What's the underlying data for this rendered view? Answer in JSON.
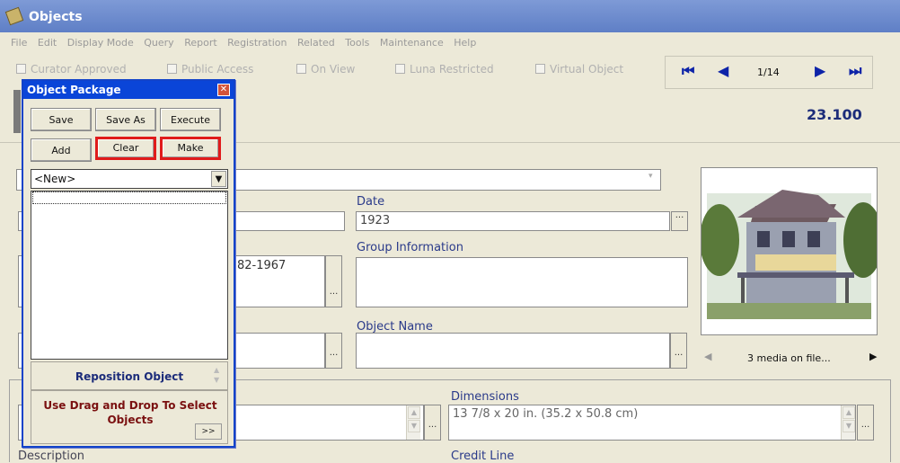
{
  "window": {
    "title": "Objects"
  },
  "menu": [
    "File",
    "Edit",
    "Display Mode",
    "Query",
    "Report",
    "Registration",
    "Related",
    "Tools",
    "Maintenance",
    "Help"
  ],
  "checkboxes": [
    "Curator Approved",
    "Public Access",
    "On View",
    "Luna Restricted",
    "Virtual Object"
  ],
  "nav": {
    "record": "1/14"
  },
  "object_number": "23.100",
  "fields": {
    "date_label": "Date",
    "date_value": "1923",
    "group_label": "Group Information",
    "group_value": "",
    "objname_label": "Object Name",
    "objname_value": "",
    "constituent_value": "82-1967",
    "dimensions_label": "Dimensions",
    "dimensions_value": "13 7/8 x 20 in. (35.2 x 50.8 cm)",
    "credit_label": "Credit Line",
    "description_label": "Description"
  },
  "media": {
    "label": "3 media on file..."
  },
  "package": {
    "title": "Object Package",
    "buttons": {
      "save": "Save",
      "save_as": "Save As",
      "execute": "Execute",
      "add": "Add",
      "clear": "Clear",
      "make": "Make"
    },
    "dropdown_value": "<New>",
    "reposition": "Reposition Object",
    "drag_text": "Use Drag and Drop To Select Objects",
    "drag_button": ">>"
  },
  "colors": {
    "title_blue": "#0a45d8",
    "highlight": "#e01b1b",
    "label": "#2a3a8a"
  }
}
